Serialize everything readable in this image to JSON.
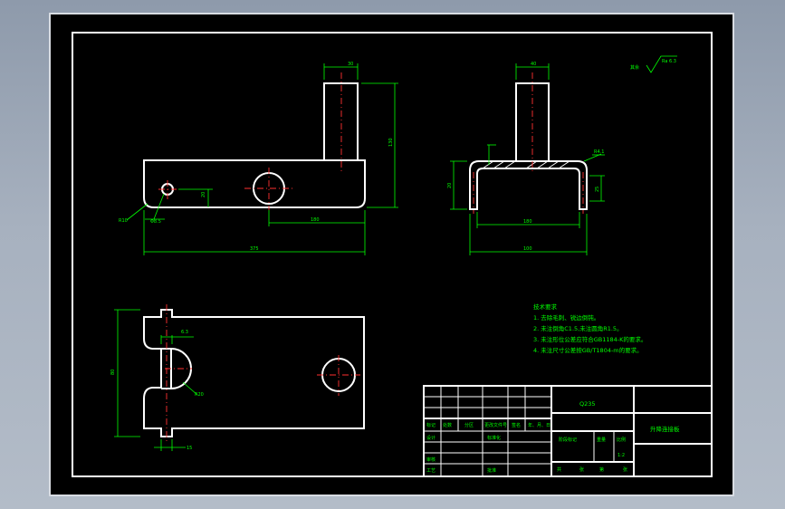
{
  "drawing": {
    "title": "升降连接板",
    "material": "Q235",
    "scale": "1:2",
    "roughness": "Ra 6.3",
    "roughness_prefix": "其余",
    "tech_requirements": {
      "heading": "技术要求",
      "items": [
        "1. 去除毛刺、锐边倒钝。",
        "2. 未注倒角C1.5,未注圆角R1.5。",
        "3. 未注形位公差应符合GB1184-K的要求。",
        "4. 未注尺寸公差按GB/T1804-m的要求。"
      ]
    },
    "dimensions": {
      "front_top_width": "30",
      "front_height": "130",
      "front_hole_offset": "20",
      "front_radius": "R10",
      "front_hole_dia": "Φ8.5",
      "front_hole_spacing": "180",
      "front_total_length": "375",
      "side_top_width": "40",
      "side_thickness_label": "R4.1",
      "side_left_height": "20",
      "side_right_height": "25",
      "side_inner_width": "180",
      "side_total_width": "100",
      "top_thickness": "6.3",
      "top_slot_radius": "R20",
      "top_height": "80",
      "top_bottom_small": "15"
    },
    "title_block": {
      "row_labels": [
        "标记",
        "处数",
        "分区",
        "更改文件号",
        "签名",
        "年、月、日"
      ],
      "design": "设计",
      "standardize": "标准化",
      "review": "审核",
      "process": "工艺",
      "approve": "批准",
      "stage_mark": "阶段标记",
      "weight": "重量",
      "ratio": "比例",
      "sheets_total": "共",
      "sheets_label": "张",
      "sheet_no": "第",
      "sheet_label": "张"
    }
  }
}
